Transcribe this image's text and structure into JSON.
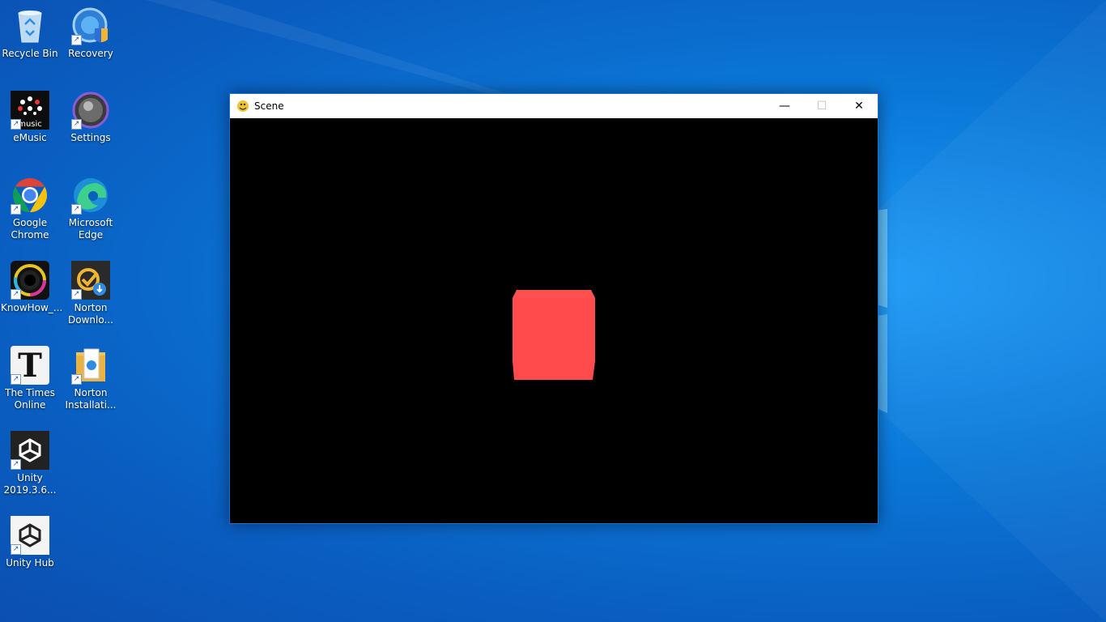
{
  "desktop": {
    "icons": [
      {
        "label": "Recycle Bin",
        "icon": "recycle-bin-icon"
      },
      {
        "label": "Recovery",
        "icon": "recovery-icon"
      },
      {
        "label": "eMusic",
        "icon": "emusic-icon",
        "text": "music"
      },
      {
        "label": "Settings",
        "icon": "settings-icon"
      },
      {
        "label": "Google Chrome",
        "icon": "chrome-icon"
      },
      {
        "label": "Microsoft Edge",
        "icon": "edge-icon"
      },
      {
        "label": "KnowHow_...",
        "icon": "knowhow-icon"
      },
      {
        "label": "Norton Downlo...",
        "icon": "norton-download-icon"
      },
      {
        "label": "The Times Online",
        "icon": "times-online-icon",
        "text": "T"
      },
      {
        "label": "Norton Installati...",
        "icon": "norton-installation-icon"
      },
      {
        "label": "Unity 2019.3.6...",
        "icon": "unity-icon"
      },
      {
        "label": "Unity Hub",
        "icon": "unity-hub-icon"
      }
    ]
  },
  "window": {
    "title": "Scene",
    "minimize_glyph": "—",
    "maximize_glyph": "☐",
    "close_glyph": "✕"
  },
  "scene": {
    "object": "cube",
    "cube_color": "#ff4b4b",
    "background_color": "#000000"
  },
  "colors": {
    "titlebar": "#ffffff",
    "desktop_accent": "#0a78d8"
  }
}
